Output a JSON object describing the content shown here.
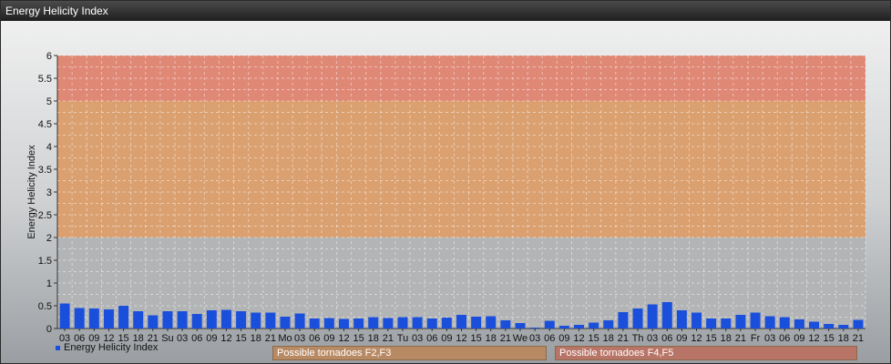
{
  "window": {
    "title": "Energy Helicity Index"
  },
  "legend": {
    "series_label": "Energy Helicity Index",
    "zone1": "Possible tornadoes F2,F3",
    "zone2": "Possible tornadoes F4,F5"
  },
  "colors": {
    "bar": "#1a4fdc",
    "zone_low": "#b3b4b6",
    "zone_mid": "#dba070",
    "zone_high": "#e08876",
    "zone1_legend": "#b88a64",
    "zone2_legend": "#b87466"
  },
  "chart_data": {
    "type": "bar",
    "ylabel": "Energy Helicity Index",
    "ylim": [
      0,
      6
    ],
    "yticks": [
      "0",
      "0.5",
      "1",
      "1.5",
      "2",
      "2.5",
      "3",
      "3.5",
      "4",
      "4.5",
      "5",
      "5.5",
      "6"
    ],
    "zones": [
      {
        "from": 0,
        "to": 2,
        "label": ""
      },
      {
        "from": 2,
        "to": 5,
        "label": "Possible tornadoes F2,F3"
      },
      {
        "from": 5,
        "to": 6,
        "label": "Possible tornadoes F4,F5"
      }
    ],
    "categories": [
      "03",
      "06",
      "09",
      "12",
      "15",
      "18",
      "21",
      "Su",
      "03",
      "06",
      "09",
      "12",
      "15",
      "18",
      "21",
      "Mo",
      "03",
      "06",
      "09",
      "12",
      "15",
      "18",
      "21",
      "Tu",
      "03",
      "06",
      "09",
      "12",
      "15",
      "18",
      "21",
      "We",
      "03",
      "06",
      "09",
      "12",
      "15",
      "18",
      "21",
      "Th",
      "03",
      "06",
      "09",
      "12",
      "15",
      "18",
      "21",
      "Fr",
      "03",
      "06",
      "09",
      "12",
      "15",
      "18",
      "21"
    ],
    "series": [
      {
        "name": "Energy Helicity Index",
        "values": [
          0.55,
          0.45,
          0.44,
          0.42,
          0.5,
          0.38,
          0.29,
          0.38,
          0.38,
          0.32,
          0.4,
          0.41,
          0.38,
          0.35,
          0.35,
          0.26,
          0.33,
          0.22,
          0.23,
          0.21,
          0.22,
          0.25,
          0.23,
          0.25,
          0.25,
          0.22,
          0.24,
          0.3,
          0.26,
          0.27,
          0.18,
          0.12,
          0.02,
          0.17,
          0.06,
          0.08,
          0.13,
          0.18,
          0.36,
          0.44,
          0.53,
          0.58,
          0.4,
          0.35,
          0.22,
          0.22,
          0.3,
          0.35,
          0.27,
          0.25,
          0.2,
          0.15,
          0.1,
          0.08,
          0.19
        ]
      }
    ]
  }
}
